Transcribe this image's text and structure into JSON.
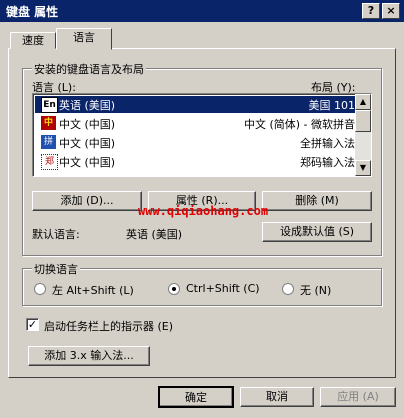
{
  "window": {
    "title": "键盘 属性",
    "help_btn": "?",
    "close_btn": "×"
  },
  "tabs": [
    {
      "label": "速度",
      "active": false
    },
    {
      "label": "语言",
      "active": true
    }
  ],
  "group_layouts": {
    "label": "安装的键盘语言及布局"
  },
  "list": {
    "col_language": "语言 (L):",
    "col_layout": "布局 (Y):",
    "rows": [
      {
        "icon": "En",
        "language": "英语 (美国)",
        "layout": "美国 101",
        "selected": true
      },
      {
        "icon": "中",
        "language": "中文 (中国)",
        "layout": "中文 (简体) - 微软拼音",
        "selected": false
      },
      {
        "icon": "拼",
        "language": "中文 (中国)",
        "layout": "全拼输入法",
        "selected": false
      },
      {
        "icon": "郑",
        "language": "中文 (中国)",
        "layout": "郑码输入法",
        "selected": false
      }
    ]
  },
  "buttons": {
    "add": "添加 (D)...",
    "properties": "属性 (R)...",
    "remove": "删除 (M)",
    "set_default": "设成默认值 (S)",
    "add_ime": "添加 3.x 输入法...",
    "ok": "确定",
    "cancel": "取消",
    "apply": "应用 (A)"
  },
  "default_language": {
    "label": "默认语言:",
    "value": "英语 (美国)"
  },
  "watermark": "www.qiqiaohang.com",
  "switch_group": {
    "label": "切换语言",
    "options": [
      {
        "label": "左 Alt+Shift (L)",
        "selected": false
      },
      {
        "label": "Ctrl+Shift (C)",
        "selected": true
      },
      {
        "label": "无 (N)",
        "selected": false
      }
    ]
  },
  "indicator": {
    "label": "启动任务栏上的指示器 (E)",
    "checked": true
  }
}
